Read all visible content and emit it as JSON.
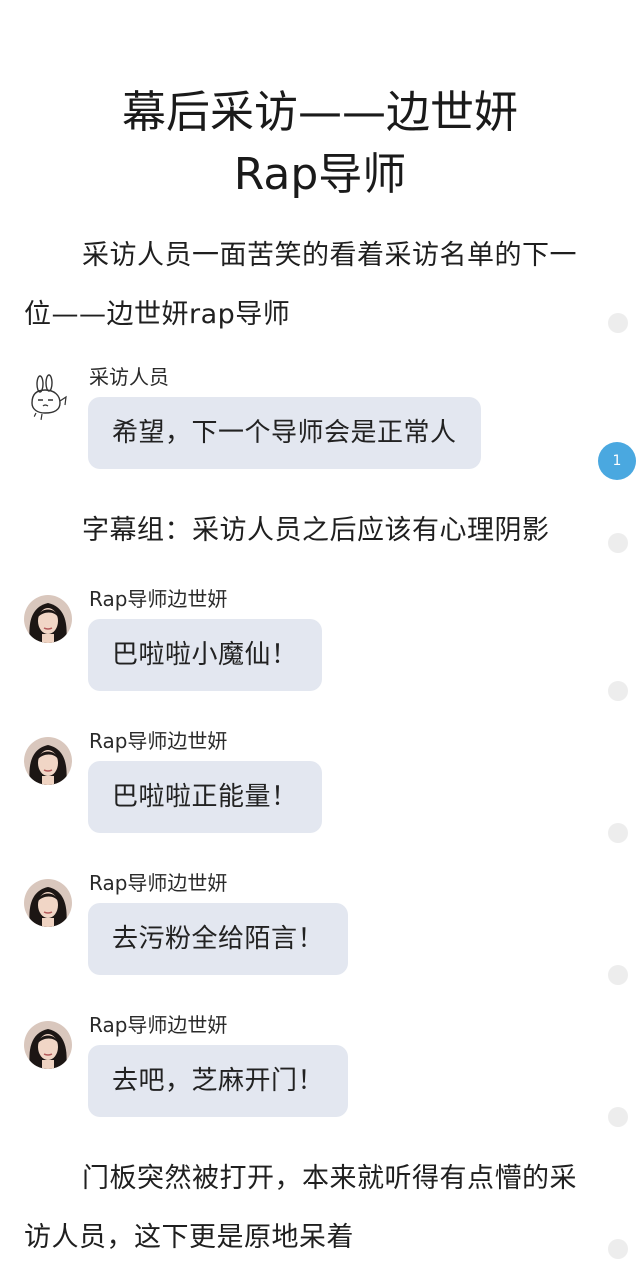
{
  "article": {
    "title_line1": "幕后采访——边世妍",
    "title_line2": "Rap导师",
    "para1": "采访人员一面苦笑的看着采访名单的下一位——边世妍rap导师",
    "para2": "字幕组：采访人员之后应该有心理阴影",
    "para3": "门板突然被打开，本来就听得有点懵的采访人员，这下更是原地呆着"
  },
  "chats": [
    {
      "speaker": "采访人员",
      "text": "希望，下一个导师会是正常人",
      "avatar": "rabbit-sketch-avatar"
    },
    {
      "speaker": "Rap导师边世妍",
      "text": "巴啦啦小魔仙！",
      "avatar": "girl-photo-avatar"
    },
    {
      "speaker": "Rap导师边世妍",
      "text": "巴啦啦正能量！",
      "avatar": "girl-photo-avatar"
    },
    {
      "speaker": "Rap导师边世妍",
      "text": "去污粉全给陌言！",
      "avatar": "girl-photo-avatar"
    },
    {
      "speaker": "Rap导师边世妍",
      "text": "去吧，芝麻开门！",
      "avatar": "girl-photo-avatar"
    }
  ],
  "side": {
    "comment_badge_count": "1",
    "dot_color": "#ededed",
    "badge_color": "#4aa8e0"
  },
  "colors": {
    "bubble": "#e3e7f0",
    "text": "#1f1f1f"
  }
}
